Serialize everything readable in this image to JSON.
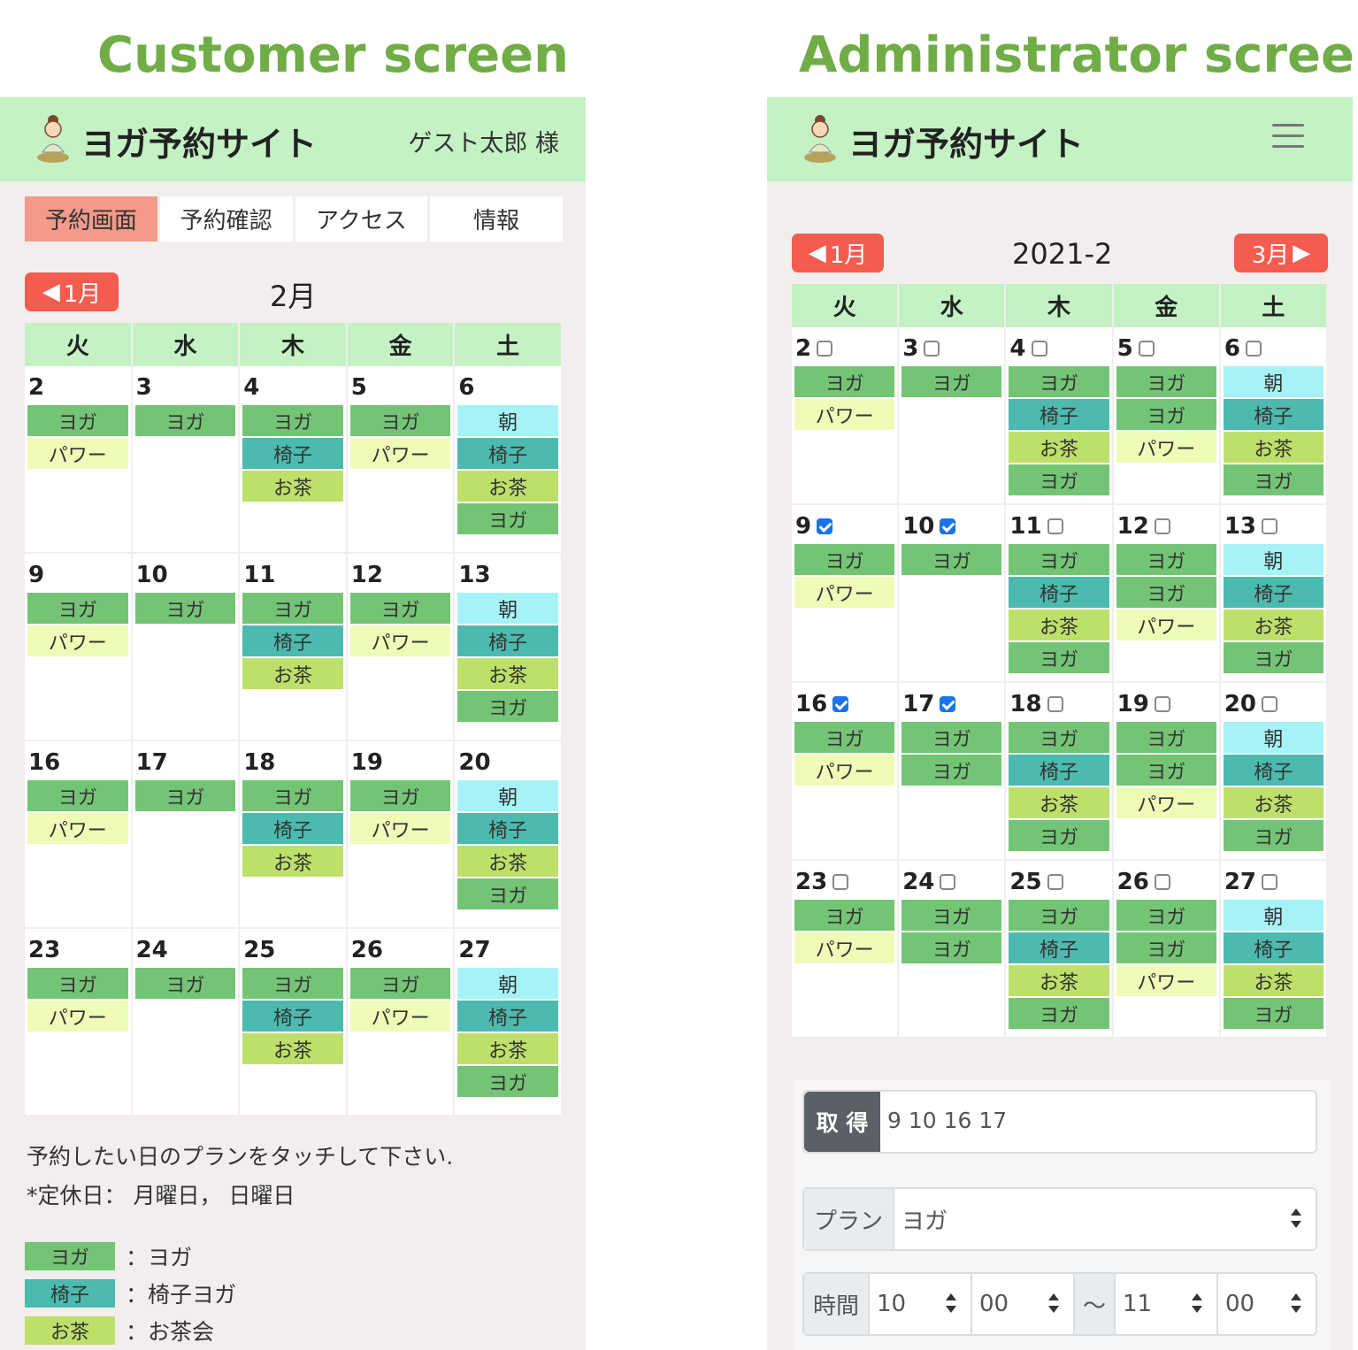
{
  "headings": {
    "customer": "Customer screen",
    "admin": "Administrator screen"
  },
  "brand": {
    "site_title": "ヨガ予約サイト",
    "logo_icon": "yoga-woman-icon"
  },
  "customer": {
    "user": "ゲスト太郎 様",
    "tabs": [
      "予約画面",
      "予約確認",
      "アクセス",
      "情報"
    ],
    "prev_month": "1月",
    "month": "2月",
    "note1": "予約したい日のプランをタッチして下さい.",
    "note2": "*定休日： 月曜日，  日曜日",
    "legend": [
      {
        "chip": "ヨガ",
        "text": "：ヨガ",
        "color": "#74c476"
      },
      {
        "chip": "椅子",
        "text": "：椅子ヨガ",
        "color": "#4cbaae"
      },
      {
        "chip": "お茶",
        "text": "：お茶会",
        "color": "#bde06a"
      }
    ]
  },
  "admin": {
    "prev_month": "1月",
    "next_month": "3月",
    "month": "2021-2",
    "get_button": "取 得",
    "get_value": "9 10 16 17",
    "plan_label": "プラン",
    "plan_value": "ヨガ",
    "time_label": "時間",
    "start_hour": "10",
    "start_min": "00",
    "tilde": "～",
    "end_hour": "11",
    "end_min": "00"
  },
  "weekdays": [
    "火",
    "水",
    "木",
    "金",
    "土"
  ],
  "colors": {
    "yoga": "#74c476",
    "isu": "#4cbaae",
    "ocha": "#bde06a",
    "asa": "#a5f3f7",
    "power": "#eefcb8",
    "accent": "#f45c4f",
    "header": "#c4f2c4"
  },
  "customer_weeks": [
    [
      {
        "d": "2",
        "p": [
          "ヨガ",
          "パワー"
        ]
      },
      {
        "d": "3",
        "p": [
          "ヨガ"
        ]
      },
      {
        "d": "4",
        "p": [
          "ヨガ",
          "椅子",
          "お茶"
        ]
      },
      {
        "d": "5",
        "p": [
          "ヨガ",
          "パワー"
        ]
      },
      {
        "d": "6",
        "p": [
          "朝",
          "椅子",
          "お茶",
          "ヨガ"
        ]
      }
    ],
    [
      {
        "d": "9",
        "p": [
          "ヨガ",
          "パワー"
        ]
      },
      {
        "d": "10",
        "p": [
          "ヨガ"
        ]
      },
      {
        "d": "11",
        "p": [
          "ヨガ",
          "椅子",
          "お茶"
        ]
      },
      {
        "d": "12",
        "p": [
          "ヨガ",
          "パワー"
        ]
      },
      {
        "d": "13",
        "p": [
          "朝",
          "椅子",
          "お茶",
          "ヨガ"
        ]
      }
    ],
    [
      {
        "d": "16",
        "p": [
          "ヨガ",
          "パワー"
        ]
      },
      {
        "d": "17",
        "p": [
          "ヨガ"
        ]
      },
      {
        "d": "18",
        "p": [
          "ヨガ",
          "椅子",
          "お茶"
        ]
      },
      {
        "d": "19",
        "p": [
          "ヨガ",
          "パワー"
        ]
      },
      {
        "d": "20",
        "p": [
          "朝",
          "椅子",
          "お茶",
          "ヨガ"
        ]
      }
    ],
    [
      {
        "d": "23",
        "p": [
          "ヨガ",
          "パワー"
        ]
      },
      {
        "d": "24",
        "p": [
          "ヨガ"
        ]
      },
      {
        "d": "25",
        "p": [
          "ヨガ",
          "椅子",
          "お茶"
        ]
      },
      {
        "d": "26",
        "p": [
          "ヨガ",
          "パワー"
        ]
      },
      {
        "d": "27",
        "p": [
          "朝",
          "椅子",
          "お茶",
          "ヨガ"
        ]
      }
    ]
  ],
  "admin_weeks": [
    [
      {
        "d": "2",
        "c": false,
        "p": [
          "ヨガ",
          "パワー"
        ]
      },
      {
        "d": "3",
        "c": false,
        "p": [
          "ヨガ"
        ]
      },
      {
        "d": "4",
        "c": false,
        "p": [
          "ヨガ",
          "椅子",
          "お茶",
          "ヨガ"
        ]
      },
      {
        "d": "5",
        "c": false,
        "p": [
          "ヨガ",
          "ヨガ",
          "パワー"
        ]
      },
      {
        "d": "6",
        "c": false,
        "p": [
          "朝",
          "椅子",
          "お茶",
          "ヨガ"
        ]
      }
    ],
    [
      {
        "d": "9",
        "c": true,
        "p": [
          "ヨガ",
          "パワー"
        ]
      },
      {
        "d": "10",
        "c": true,
        "p": [
          "ヨガ"
        ]
      },
      {
        "d": "11",
        "c": false,
        "p": [
          "ヨガ",
          "椅子",
          "お茶",
          "ヨガ"
        ]
      },
      {
        "d": "12",
        "c": false,
        "p": [
          "ヨガ",
          "ヨガ",
          "パワー"
        ]
      },
      {
        "d": "13",
        "c": false,
        "p": [
          "朝",
          "椅子",
          "お茶",
          "ヨガ"
        ]
      }
    ],
    [
      {
        "d": "16",
        "c": true,
        "p": [
          "ヨガ",
          "パワー"
        ]
      },
      {
        "d": "17",
        "c": true,
        "p": [
          "ヨガ",
          "ヨガ"
        ]
      },
      {
        "d": "18",
        "c": false,
        "p": [
          "ヨガ",
          "椅子",
          "お茶",
          "ヨガ"
        ]
      },
      {
        "d": "19",
        "c": false,
        "p": [
          "ヨガ",
          "ヨガ",
          "パワー"
        ]
      },
      {
        "d": "20",
        "c": false,
        "p": [
          "朝",
          "椅子",
          "お茶",
          "ヨガ"
        ]
      }
    ],
    [
      {
        "d": "23",
        "c": false,
        "p": [
          "ヨガ",
          "パワー"
        ]
      },
      {
        "d": "24",
        "c": false,
        "p": [
          "ヨガ",
          "ヨガ"
        ]
      },
      {
        "d": "25",
        "c": false,
        "p": [
          "ヨガ",
          "椅子",
          "お茶",
          "ヨガ"
        ]
      },
      {
        "d": "26",
        "c": false,
        "p": [
          "ヨガ",
          "ヨガ",
          "パワー"
        ]
      },
      {
        "d": "27",
        "c": false,
        "p": [
          "朝",
          "椅子",
          "お茶",
          "ヨガ"
        ]
      }
    ]
  ]
}
